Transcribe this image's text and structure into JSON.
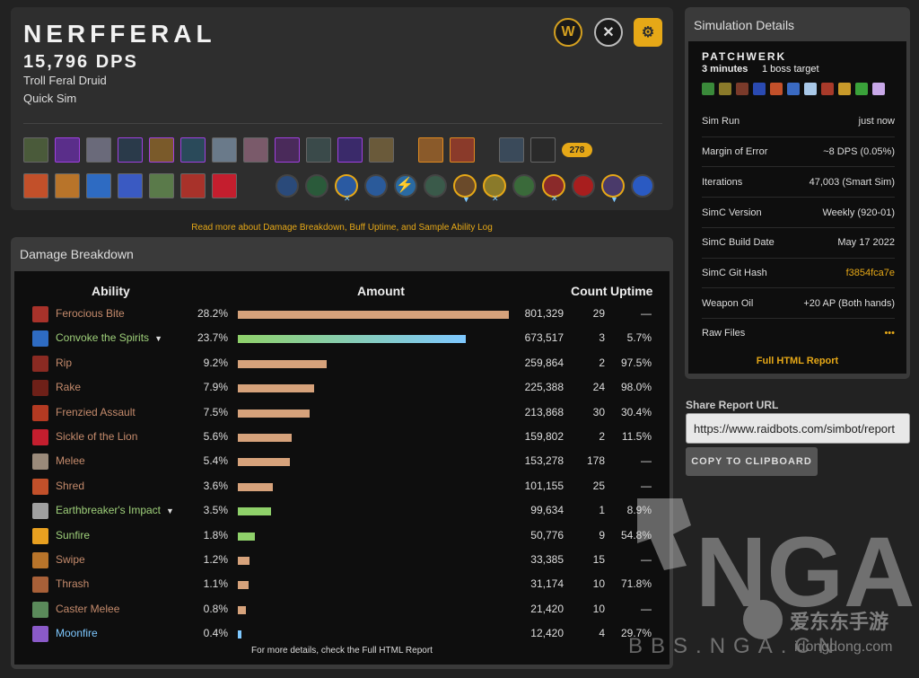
{
  "character": {
    "name": "NERFFERAL",
    "dps": "15,796 DPS",
    "spec": "Troll Feral Druid",
    "sim_type": "Quick Sim",
    "item_level": "278",
    "header_icons": [
      "warcraft-logo-icon",
      "raiderio-icon",
      "raidbots-icon"
    ]
  },
  "links": {
    "read_more": "Read more about Damage Breakdown, Buff Uptime, and Sample Ability Log"
  },
  "damage_breakdown": {
    "title": "Damage Breakdown",
    "headers": {
      "ability": "Ability",
      "amount": "Amount",
      "count": "Count",
      "uptime": "Uptime"
    },
    "rows": [
      {
        "name": "Ferocious Bite",
        "pct": "28.2%",
        "share": 28.2,
        "amount": "801,329",
        "count": "29",
        "uptime": "—",
        "color": "#c58b6c",
        "expand": false,
        "bar": "#d6a27b",
        "icon": "#a8322a"
      },
      {
        "name": "Convoke the Spirits",
        "pct": "23.7%",
        "share": 23.7,
        "amount": "673,517",
        "count": "3",
        "uptime": "5.7%",
        "color": "#9fd07a",
        "expand": true,
        "bar": "grad",
        "icon": "#2e6bc2"
      },
      {
        "name": "Rip",
        "pct": "9.2%",
        "share": 9.2,
        "amount": "259,864",
        "count": "2",
        "uptime": "97.5%",
        "color": "#c58b6c",
        "expand": false,
        "bar": "#d6a27b",
        "icon": "#8a2a22"
      },
      {
        "name": "Rake",
        "pct": "7.9%",
        "share": 7.9,
        "amount": "225,388",
        "count": "24",
        "uptime": "98.0%",
        "color": "#c58b6c",
        "expand": false,
        "bar": "#d6a27b",
        "icon": "#6e2018"
      },
      {
        "name": "Frenzied Assault",
        "pct": "7.5%",
        "share": 7.5,
        "amount": "213,868",
        "count": "30",
        "uptime": "30.4%",
        "color": "#c58b6c",
        "expand": false,
        "bar": "#d6a27b",
        "icon": "#b33a22"
      },
      {
        "name": "Sickle of the Lion",
        "pct": "5.6%",
        "share": 5.6,
        "amount": "159,802",
        "count": "2",
        "uptime": "11.5%",
        "color": "#c58b6c",
        "expand": false,
        "bar": "#d6a27b",
        "icon": "#c41e2e"
      },
      {
        "name": "Melee",
        "pct": "5.4%",
        "share": 5.4,
        "amount": "153,278",
        "count": "178",
        "uptime": "—",
        "color": "#c58b6c",
        "expand": false,
        "bar": "#d6a27b",
        "icon": "#9a8a7a"
      },
      {
        "name": "Shred",
        "pct": "3.6%",
        "share": 3.6,
        "amount": "101,155",
        "count": "25",
        "uptime": "—",
        "color": "#c58b6c",
        "expand": false,
        "bar": "#d6a27b",
        "icon": "#c2502a"
      },
      {
        "name": "Earthbreaker's Impact",
        "pct": "3.5%",
        "share": 3.5,
        "amount": "99,634",
        "count": "1",
        "uptime": "8.9%",
        "color": "#9fd07a",
        "expand": true,
        "bar": "#8fd16a",
        "icon": "#a0a0a0"
      },
      {
        "name": "Sunfire",
        "pct": "1.8%",
        "share": 1.8,
        "amount": "50,776",
        "count": "9",
        "uptime": "54.8%",
        "color": "#9fd07a",
        "expand": false,
        "bar": "#8fd16a",
        "icon": "#e8a020"
      },
      {
        "name": "Swipe",
        "pct": "1.2%",
        "share": 1.2,
        "amount": "33,385",
        "count": "15",
        "uptime": "—",
        "color": "#c58b6c",
        "expand": false,
        "bar": "#d6a27b",
        "icon": "#b8742a"
      },
      {
        "name": "Thrash",
        "pct": "1.1%",
        "share": 1.1,
        "amount": "31,174",
        "count": "10",
        "uptime": "71.8%",
        "color": "#c58b6c",
        "expand": false,
        "bar": "#d6a27b",
        "icon": "#a86038"
      },
      {
        "name": "Caster Melee",
        "pct": "0.8%",
        "share": 0.8,
        "amount": "21,420",
        "count": "10",
        "uptime": "—",
        "color": "#c58b6c",
        "expand": false,
        "bar": "#d6a27b",
        "icon": "#5a8a5a"
      },
      {
        "name": "Moonfire",
        "pct": "0.4%",
        "share": 0.4,
        "amount": "12,420",
        "count": "4",
        "uptime": "29.7%",
        "color": "#7ec8ff",
        "expand": false,
        "bar": "#7ec8ff",
        "icon": "#8a5ac8"
      }
    ],
    "footer": "For more details, check the Full HTML Report"
  },
  "simulation": {
    "title": "Simulation Details",
    "fight_style": "PATCHWERK",
    "duration": "3 minutes",
    "targets": "1 boss target",
    "details": [
      {
        "label": "Sim Run",
        "value": "just now",
        "accent": false
      },
      {
        "label": "Margin of Error",
        "value": "~8 DPS (0.05%)",
        "accent": false
      },
      {
        "label": "Iterations",
        "value": "47,003 (Smart Sim)",
        "accent": false
      },
      {
        "label": "SimC Version",
        "value": "Weekly (920-01)",
        "accent": false
      },
      {
        "label": "SimC Build Date",
        "value": "May 17 2022",
        "accent": false
      },
      {
        "label": "SimC Git Hash",
        "value": "f3854fca7e",
        "accent": true
      },
      {
        "label": "Weapon Oil",
        "value": "+20 AP (Both hands)",
        "accent": false
      },
      {
        "label": "Raw Files",
        "value": "•••",
        "accent": true
      }
    ],
    "full_report": "Full HTML Report"
  },
  "share": {
    "label": "Share Report URL",
    "url": "https://www.raidbots.com/simbot/report",
    "copy_button": "COPY TO CLIPBOARD"
  },
  "watermark": {
    "brand": "NGA",
    "site": "BBS.NGA.CN",
    "cn": "爱东东手游",
    "domain": "idongdong.com"
  },
  "colors": {
    "accent": "#e6a817",
    "bar_default": "#d6a27b",
    "bar_green": "#8fd16a",
    "bar_blue": "#7ec8ff"
  }
}
